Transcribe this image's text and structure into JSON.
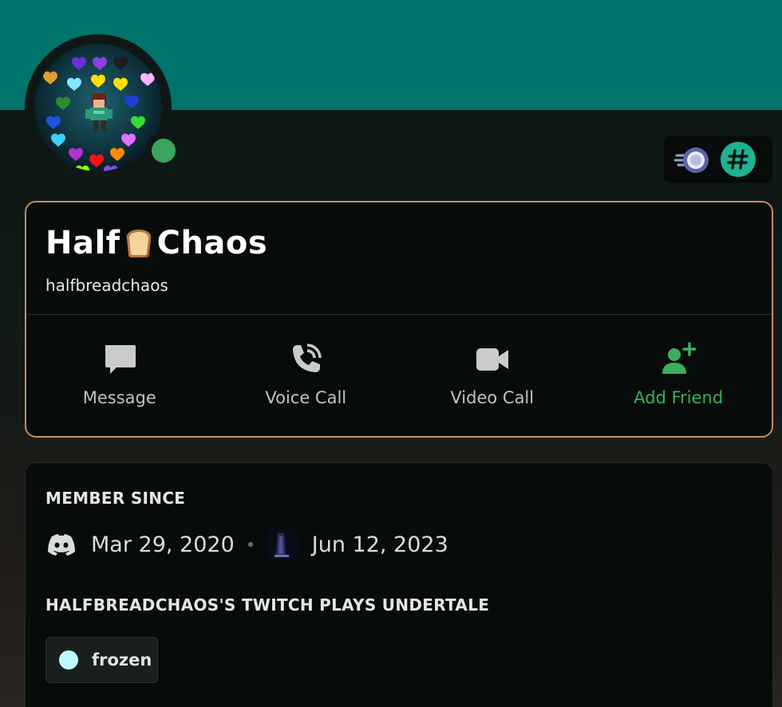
{
  "profile": {
    "display_name_part1": "Half",
    "display_name_part2": "Chaos",
    "display_name_emoji": "bread-emoji",
    "username": "halfbreadchaos",
    "status": "online",
    "status_color": "#3ba55d",
    "banner_color": "#00736a",
    "border_color": "#c48d60"
  },
  "badges": [
    {
      "icon": "nitro-boost-badge-icon"
    },
    {
      "icon": "hashtag-badge-icon"
    }
  ],
  "actions": {
    "message_label": "Message",
    "voice_call_label": "Voice Call",
    "video_call_label": "Video Call",
    "add_friend_label": "Add Friend",
    "add_friend_color": "#3bae5c"
  },
  "member_since": {
    "title": "MEMBER SINCE",
    "discord_date": "Mar 29, 2020",
    "server_date": "Jun 12, 2023"
  },
  "server_roles": {
    "title": "HALFBREADCHAOS'S TWITCH PLAYS UNDERTALE",
    "roles": [
      {
        "name": "frozen",
        "color": "#b9fbff"
      }
    ]
  }
}
